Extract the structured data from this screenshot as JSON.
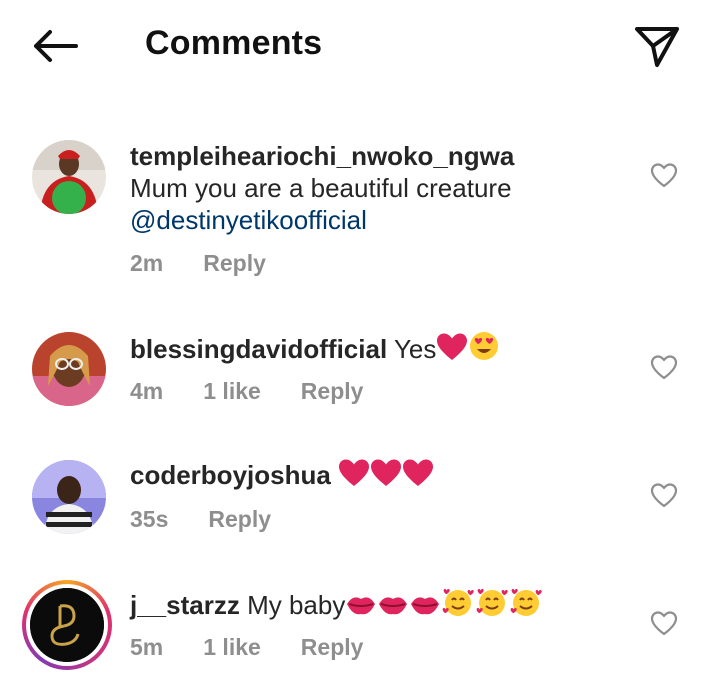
{
  "header": {
    "title": "Comments",
    "back_icon": "arrow-left-icon",
    "send_icon": "paper-plane-icon"
  },
  "comments": [
    {
      "username": "templeiheariochi_nwoko_ngwa",
      "text": "Mum you are a beautiful creature",
      "mention": "@destinyetikoofficial",
      "time": "2m",
      "likes": "",
      "reply_label": "Reply"
    },
    {
      "username": "blessingdavidofficial",
      "text": "Yes",
      "emojis": [
        "red-heart",
        "heart-eyes-face"
      ],
      "time": "4m",
      "likes": "1 like",
      "reply_label": "Reply"
    },
    {
      "username": "coderboyjoshua",
      "text": "",
      "emojis": [
        "red-heart",
        "red-heart",
        "red-heart"
      ],
      "time": "35s",
      "likes": "",
      "reply_label": "Reply"
    },
    {
      "username": "j__starzz",
      "text": "My baby",
      "emojis": [
        "kiss-mark",
        "kiss-mark",
        "kiss-mark",
        "smiling-face-with-hearts",
        "smiling-face-with-hearts",
        "smiling-face-with-hearts"
      ],
      "time": "5m",
      "likes": "1 like",
      "reply_label": "Reply"
    }
  ],
  "colors": {
    "text": "#262626",
    "muted": "#8e8e8e",
    "mention": "#00376b",
    "heart_red": "#e0245e"
  }
}
